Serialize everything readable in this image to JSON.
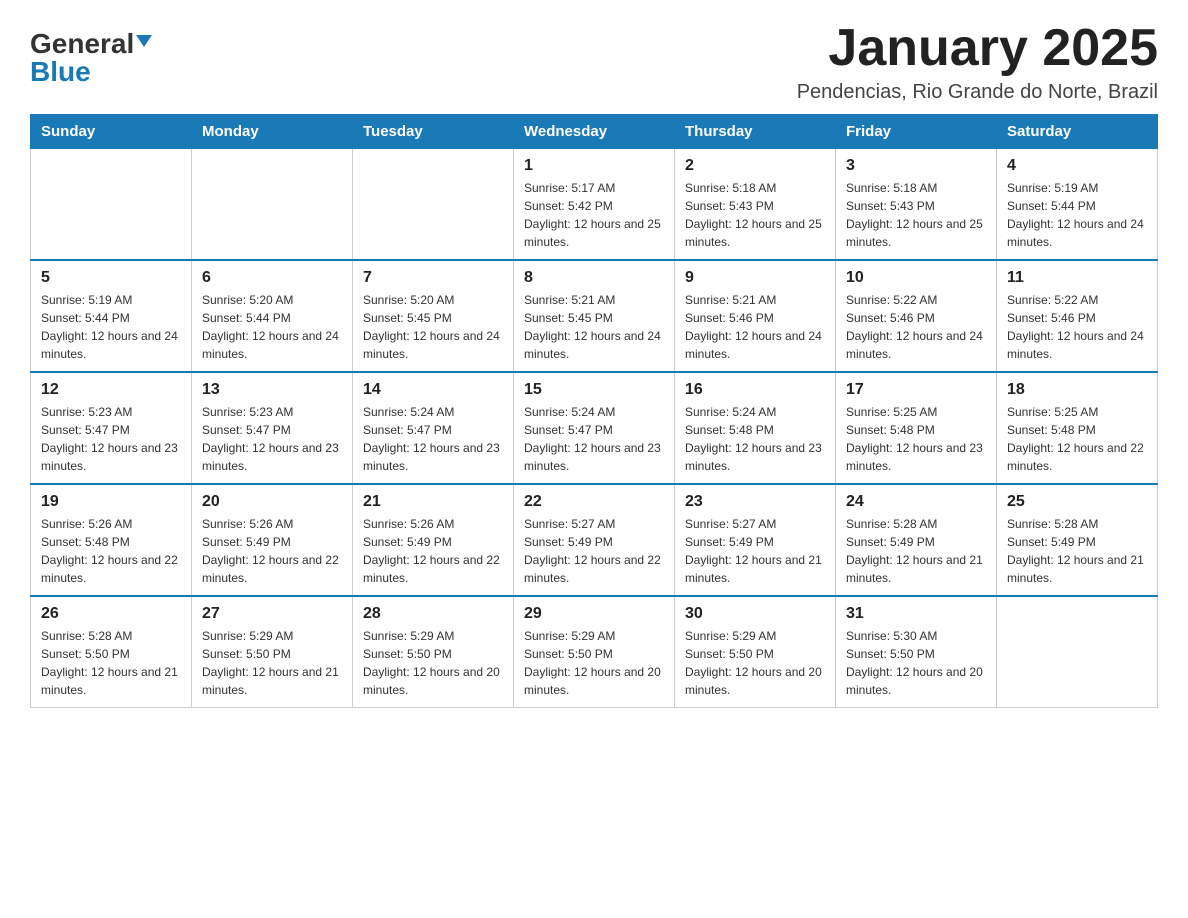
{
  "header": {
    "logo_black": "General",
    "logo_blue": "Blue",
    "month_title": "January 2025",
    "location": "Pendencias, Rio Grande do Norte, Brazil"
  },
  "days_of_week": [
    "Sunday",
    "Monday",
    "Tuesday",
    "Wednesday",
    "Thursday",
    "Friday",
    "Saturday"
  ],
  "weeks": [
    [
      {
        "day": "",
        "info": ""
      },
      {
        "day": "",
        "info": ""
      },
      {
        "day": "",
        "info": ""
      },
      {
        "day": "1",
        "info": "Sunrise: 5:17 AM\nSunset: 5:42 PM\nDaylight: 12 hours and 25 minutes."
      },
      {
        "day": "2",
        "info": "Sunrise: 5:18 AM\nSunset: 5:43 PM\nDaylight: 12 hours and 25 minutes."
      },
      {
        "day": "3",
        "info": "Sunrise: 5:18 AM\nSunset: 5:43 PM\nDaylight: 12 hours and 25 minutes."
      },
      {
        "day": "4",
        "info": "Sunrise: 5:19 AM\nSunset: 5:44 PM\nDaylight: 12 hours and 24 minutes."
      }
    ],
    [
      {
        "day": "5",
        "info": "Sunrise: 5:19 AM\nSunset: 5:44 PM\nDaylight: 12 hours and 24 minutes."
      },
      {
        "day": "6",
        "info": "Sunrise: 5:20 AM\nSunset: 5:44 PM\nDaylight: 12 hours and 24 minutes."
      },
      {
        "day": "7",
        "info": "Sunrise: 5:20 AM\nSunset: 5:45 PM\nDaylight: 12 hours and 24 minutes."
      },
      {
        "day": "8",
        "info": "Sunrise: 5:21 AM\nSunset: 5:45 PM\nDaylight: 12 hours and 24 minutes."
      },
      {
        "day": "9",
        "info": "Sunrise: 5:21 AM\nSunset: 5:46 PM\nDaylight: 12 hours and 24 minutes."
      },
      {
        "day": "10",
        "info": "Sunrise: 5:22 AM\nSunset: 5:46 PM\nDaylight: 12 hours and 24 minutes."
      },
      {
        "day": "11",
        "info": "Sunrise: 5:22 AM\nSunset: 5:46 PM\nDaylight: 12 hours and 24 minutes."
      }
    ],
    [
      {
        "day": "12",
        "info": "Sunrise: 5:23 AM\nSunset: 5:47 PM\nDaylight: 12 hours and 23 minutes."
      },
      {
        "day": "13",
        "info": "Sunrise: 5:23 AM\nSunset: 5:47 PM\nDaylight: 12 hours and 23 minutes."
      },
      {
        "day": "14",
        "info": "Sunrise: 5:24 AM\nSunset: 5:47 PM\nDaylight: 12 hours and 23 minutes."
      },
      {
        "day": "15",
        "info": "Sunrise: 5:24 AM\nSunset: 5:47 PM\nDaylight: 12 hours and 23 minutes."
      },
      {
        "day": "16",
        "info": "Sunrise: 5:24 AM\nSunset: 5:48 PM\nDaylight: 12 hours and 23 minutes."
      },
      {
        "day": "17",
        "info": "Sunrise: 5:25 AM\nSunset: 5:48 PM\nDaylight: 12 hours and 23 minutes."
      },
      {
        "day": "18",
        "info": "Sunrise: 5:25 AM\nSunset: 5:48 PM\nDaylight: 12 hours and 22 minutes."
      }
    ],
    [
      {
        "day": "19",
        "info": "Sunrise: 5:26 AM\nSunset: 5:48 PM\nDaylight: 12 hours and 22 minutes."
      },
      {
        "day": "20",
        "info": "Sunrise: 5:26 AM\nSunset: 5:49 PM\nDaylight: 12 hours and 22 minutes."
      },
      {
        "day": "21",
        "info": "Sunrise: 5:26 AM\nSunset: 5:49 PM\nDaylight: 12 hours and 22 minutes."
      },
      {
        "day": "22",
        "info": "Sunrise: 5:27 AM\nSunset: 5:49 PM\nDaylight: 12 hours and 22 minutes."
      },
      {
        "day": "23",
        "info": "Sunrise: 5:27 AM\nSunset: 5:49 PM\nDaylight: 12 hours and 21 minutes."
      },
      {
        "day": "24",
        "info": "Sunrise: 5:28 AM\nSunset: 5:49 PM\nDaylight: 12 hours and 21 minutes."
      },
      {
        "day": "25",
        "info": "Sunrise: 5:28 AM\nSunset: 5:49 PM\nDaylight: 12 hours and 21 minutes."
      }
    ],
    [
      {
        "day": "26",
        "info": "Sunrise: 5:28 AM\nSunset: 5:50 PM\nDaylight: 12 hours and 21 minutes."
      },
      {
        "day": "27",
        "info": "Sunrise: 5:29 AM\nSunset: 5:50 PM\nDaylight: 12 hours and 21 minutes."
      },
      {
        "day": "28",
        "info": "Sunrise: 5:29 AM\nSunset: 5:50 PM\nDaylight: 12 hours and 20 minutes."
      },
      {
        "day": "29",
        "info": "Sunrise: 5:29 AM\nSunset: 5:50 PM\nDaylight: 12 hours and 20 minutes."
      },
      {
        "day": "30",
        "info": "Sunrise: 5:29 AM\nSunset: 5:50 PM\nDaylight: 12 hours and 20 minutes."
      },
      {
        "day": "31",
        "info": "Sunrise: 5:30 AM\nSunset: 5:50 PM\nDaylight: 12 hours and 20 minutes."
      },
      {
        "day": "",
        "info": ""
      }
    ]
  ]
}
